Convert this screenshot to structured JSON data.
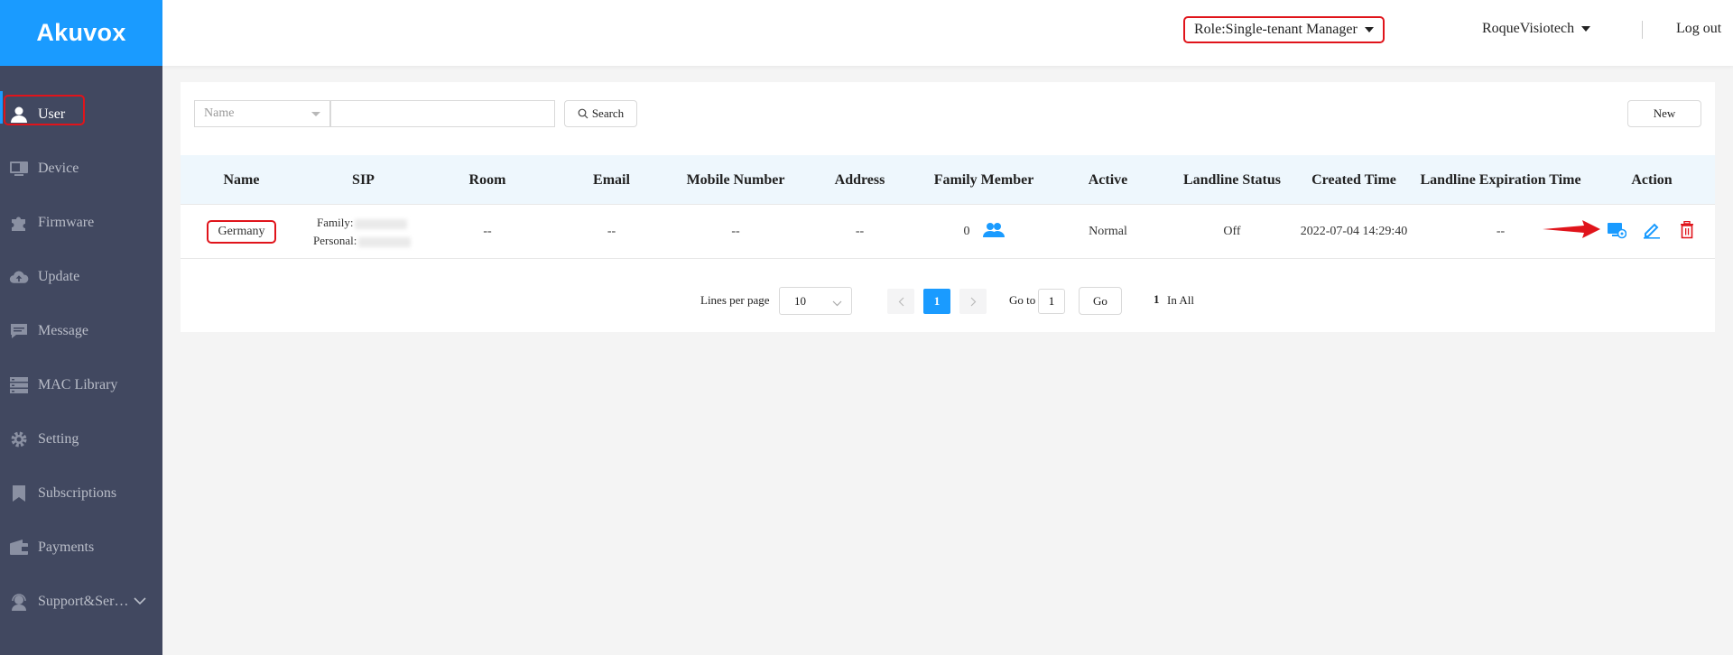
{
  "app": {
    "logo": "Akuvox"
  },
  "sidebar": {
    "items": [
      {
        "label": "User",
        "icon": "user-icon",
        "active": true
      },
      {
        "label": "Device",
        "icon": "device-icon"
      },
      {
        "label": "Firmware",
        "icon": "puzzle-icon"
      },
      {
        "label": "Update",
        "icon": "cloud-upload-icon"
      },
      {
        "label": "Message",
        "icon": "message-icon"
      },
      {
        "label": "MAC Library",
        "icon": "server-icon"
      },
      {
        "label": "Setting",
        "icon": "gear-icon"
      },
      {
        "label": "Subscriptions",
        "icon": "bookmark-icon"
      },
      {
        "label": "Payments",
        "icon": "wallet-icon"
      },
      {
        "label": "Support&Ser…",
        "icon": "headset-icon"
      }
    ]
  },
  "header": {
    "role": "Role:Single-tenant Manager",
    "account": "RoqueVisiotech",
    "logout": "Log out"
  },
  "toolbar": {
    "filter_placeholder": "Name",
    "search_value": "",
    "search_label": "Search",
    "new_label": "New"
  },
  "table": {
    "columns": [
      "Name",
      "SIP",
      "Room",
      "Email",
      "Mobile Number",
      "Address",
      "Family Member",
      "Active",
      "Landline Status",
      "Created Time",
      "Landline Expiration Time",
      "Action"
    ],
    "rows": [
      {
        "name": "Germany",
        "sip_family_label": "Family:",
        "sip_personal_label": "Personal:",
        "room": "--",
        "email": "--",
        "mobile": "--",
        "address": "--",
        "family_member": "0",
        "active": "Normal",
        "landline_status": "Off",
        "created_time": "2022-07-04 14:29:40",
        "landline_expiration": "--"
      }
    ]
  },
  "pagination": {
    "lines_per_page_label": "Lines per page",
    "lines_per_page": "10",
    "current_page": "1",
    "goto_label": "Go to",
    "goto_value": "1",
    "go_label": "Go",
    "total": "1",
    "in_all_label": "In All"
  },
  "colors": {
    "brand": "#1a9bff",
    "sidebar": "#414860",
    "highlight": "#e0141b",
    "delete": "#e0141b"
  }
}
